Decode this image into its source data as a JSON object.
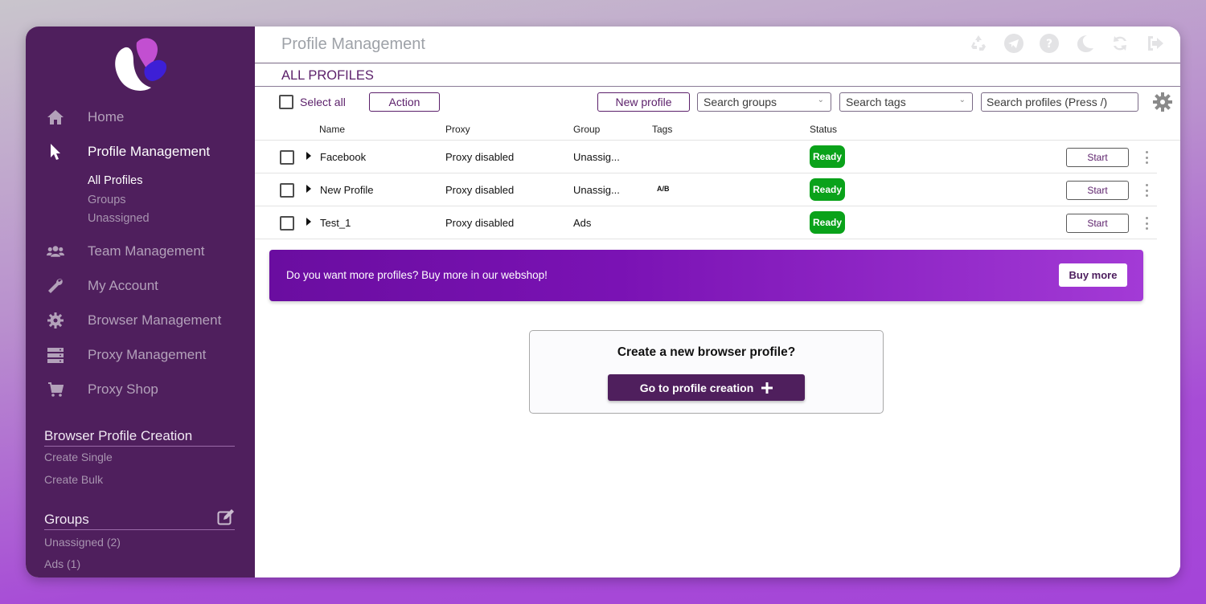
{
  "sidebar": {
    "nav": [
      {
        "label": "Home",
        "icon": "home-icon"
      },
      {
        "label": "Profile Management",
        "icon": "cursor-icon"
      },
      {
        "label": "Team Management",
        "icon": "users-icon"
      },
      {
        "label": "My Account",
        "icon": "wrench-icon"
      },
      {
        "label": "Browser Management",
        "icon": "gear-icon"
      },
      {
        "label": "Proxy Management",
        "icon": "server-icon"
      },
      {
        "label": "Proxy Shop",
        "icon": "cart-icon"
      }
    ],
    "profile_sub": [
      "All Profiles",
      "Groups",
      "Unassigned"
    ],
    "creation": {
      "title": "Browser Profile Creation",
      "links": [
        "Create Single",
        "Create Bulk"
      ]
    },
    "groups": {
      "title": "Groups",
      "items": [
        "Unassigned (2)",
        "Ads (1)"
      ]
    }
  },
  "header": {
    "title": "Profile Management",
    "section": "ALL PROFILES",
    "icons": [
      "recycle-icon",
      "telegram-icon",
      "help-icon",
      "moon-icon",
      "refresh-icon",
      "logout-icon"
    ]
  },
  "toolbar": {
    "select_all": "Select all",
    "action": "Action",
    "new_profile": "New profile",
    "search_groups": "Search groups",
    "search_tags": "Search tags",
    "search_profiles_placeholder": "Search profiles (Press /)"
  },
  "table": {
    "columns": [
      "Name",
      "Proxy",
      "Group",
      "Tags",
      "Status"
    ],
    "rows": [
      {
        "name": "Facebook",
        "proxy": "Proxy disabled",
        "group": "Unassig...",
        "tags": "",
        "status": "Ready",
        "action": "Start"
      },
      {
        "name": "New Profile",
        "proxy": "Proxy disabled",
        "group": "Unassig...",
        "tags": "A/B",
        "status": "Ready",
        "action": "Start"
      },
      {
        "name": "Test_1",
        "proxy": "Proxy disabled",
        "group": "Ads",
        "tags": "",
        "status": "Ready",
        "action": "Start"
      }
    ]
  },
  "banner": {
    "text": "Do you want more profiles? Buy more in our webshop!",
    "button": "Buy more"
  },
  "create": {
    "question": "Create a new browser profile?",
    "button": "Go to profile creation"
  },
  "colors": {
    "sidebar_bg": "#4f1f5d",
    "accent": "#5b1f6a",
    "ready_green": "#0aa21a"
  }
}
